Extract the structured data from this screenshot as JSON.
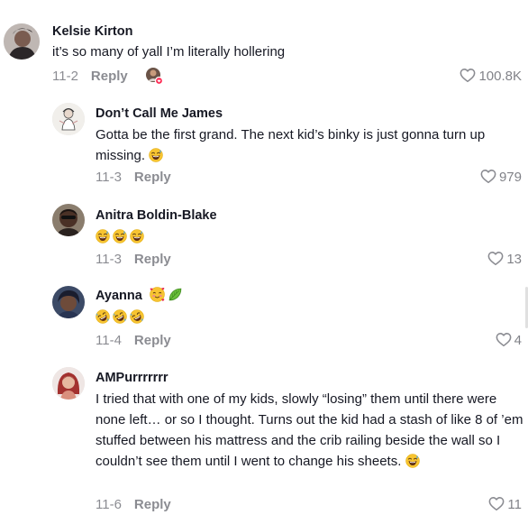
{
  "comments": [
    {
      "username": "Kelsie Kirton",
      "text": "it’s so many of yall I’m literally hollering",
      "date": "11-2",
      "reply_label": "Reply",
      "likes": "100.8K"
    },
    {
      "username": "Don’t Call Me James",
      "text": "Gotta be the first grand. The next kid’s binky is just gonna turn up missing.",
      "date": "11-3",
      "reply_label": "Reply",
      "likes": "979"
    },
    {
      "username": "Anitra Boldin-Blake",
      "text": "",
      "date": "11-3",
      "reply_label": "Reply",
      "likes": "13"
    },
    {
      "username": "Ayanna",
      "text": "",
      "date": "11-4",
      "reply_label": "Reply",
      "likes": "4"
    },
    {
      "username": "AMPurrrrrrr",
      "text": "I tried that with one of my kids, slowly “losing” them until there were none left… or so I thought. Turns out the kid had a stash of like 8 of ’em stuffed between his mattress and the crib railing beside the wall so I couldn’t see them until I went to change his sheets.",
      "date": "11-6",
      "reply_label": "Reply",
      "likes": "11"
    }
  ],
  "icons": {
    "like": "heart-outline-icon",
    "laugh": "grinning-sweat-emoji",
    "rofl": "rolling-laughing-emoji",
    "heart_eyes": "smiling-hearts-emoji",
    "leaf": "leaf-emoji"
  },
  "colors": {
    "text": "#161823",
    "muted": "#8a8b91"
  }
}
